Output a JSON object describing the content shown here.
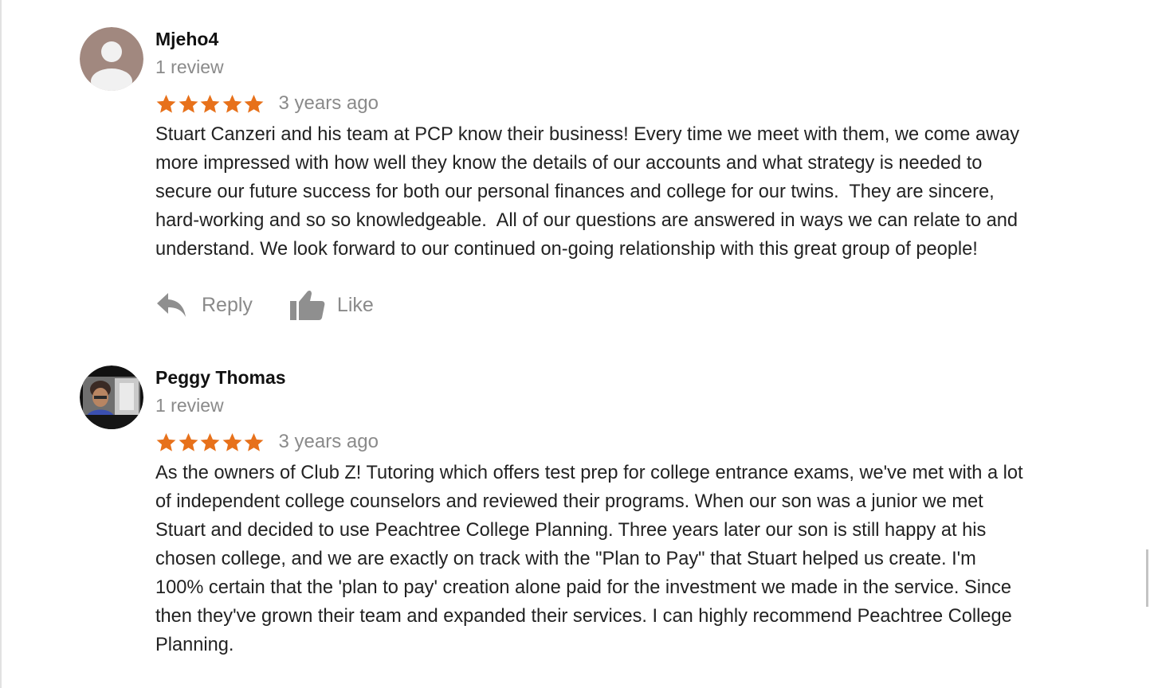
{
  "reviews": [
    {
      "author": "Mjeho4",
      "review_count": "1 review",
      "rating": 5,
      "rating_max": 5,
      "date": "3 years ago",
      "text": "Stuart Canzeri and his team at PCP know their business! Every time we meet with them, we come away\nmore impressed with how well they know the details of our accounts and what strategy is needed to\nsecure our future success for both our personal finances and college for our twins.  They are sincere,\nhard-working and so so knowledgeable.  All of our questions are answered in ways we can relate to and\nunderstand. We look forward to our continued on-going relationship with this great group of people!",
      "reply_label": "Reply",
      "like_label": "Like",
      "avatar_icon": "default-user-avatar"
    },
    {
      "author": "Peggy Thomas",
      "review_count": "1 review",
      "rating": 5,
      "rating_max": 5,
      "date": "3 years ago",
      "text": "As the owners of Club Z! Tutoring which offers test prep for college entrance exams, we've met with a lot\nof independent college counselors and reviewed their programs. When our son was a junior we met\nStuart and decided to use Peachtree College Planning. Three years later our son is still happy at his\nchosen college, and we are exactly on track with the \"Plan to Pay\" that Stuart helped us create. I'm\n100% certain that the 'plan to pay' creation alone paid for the investment we made in the service. Since\nthen they've grown their team and expanded their services. I can highly recommend Peachtree College\nPlanning.",
      "avatar_icon": "user-photo-avatar"
    }
  ],
  "colors": {
    "star": "#e7711b",
    "muted_text": "#8a8a8a",
    "body_text": "#222222",
    "icon": "#8f8f8f"
  }
}
